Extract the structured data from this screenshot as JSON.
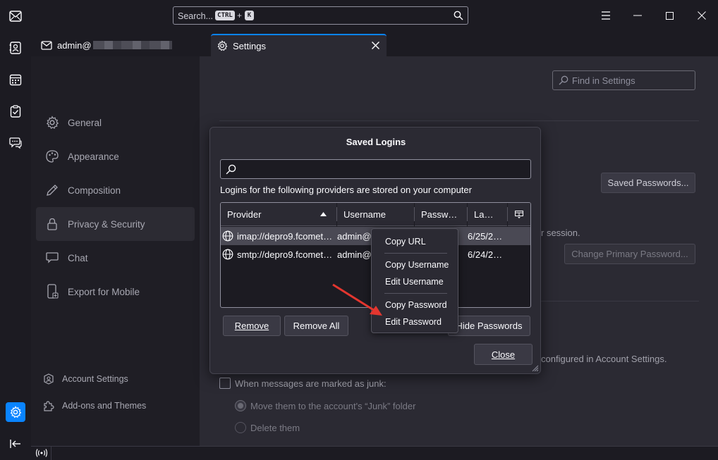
{
  "titlebar": {
    "search_placeholder": "Search...",
    "shortcut_key1": "CTRL",
    "shortcut_plus": "+",
    "shortcut_key2": "K"
  },
  "tabs": [
    {
      "label": "admin@",
      "icon": "mail-icon"
    },
    {
      "label": "Settings",
      "icon": "gear-icon"
    }
  ],
  "settings": {
    "find_placeholder": "Find in Settings",
    "categories": [
      {
        "label": "General",
        "icon": "gear-icon"
      },
      {
        "label": "Appearance",
        "icon": "palette-icon"
      },
      {
        "label": "Composition",
        "icon": "pencil-icon"
      },
      {
        "label": "Privacy & Security",
        "icon": "lock-icon"
      },
      {
        "label": "Chat",
        "icon": "chat-icon"
      },
      {
        "label": "Export for Mobile",
        "icon": "mobile-icon"
      }
    ],
    "bottom_links": [
      {
        "label": "Account Settings",
        "icon": "account-icon"
      },
      {
        "label": "Add-ons and Themes",
        "icon": "puzzle-icon"
      }
    ],
    "saved_passwords_button": "Saved Passwords...",
    "session_text": "r session.",
    "change_primary_password": "Change Primary Password...",
    "account_settings_text": "configured in Account Settings.",
    "junk_checkbox_label": "When messages are marked as junk:",
    "junk_option_move": "Move them to the account's “Junk” folder",
    "junk_option_delete": "Delete them"
  },
  "dialog": {
    "title": "Saved Logins",
    "info": "Logins for the following providers are stored on your computer",
    "columns": [
      "Provider",
      "Username",
      "Passw…",
      "La…"
    ],
    "rows": [
      {
        "provider": "imap://depro9.fcomet…",
        "username": "admin@",
        "last": "6/25/2…"
      },
      {
        "provider": "smtp://depro9.fcomet…",
        "username": "admin@",
        "last": "6/24/2…"
      }
    ],
    "remove_button": "Remove",
    "remove_all_button": "Remove All",
    "hide_passwords_button": "Hide Passwords",
    "close_button": "Close"
  },
  "context_menu": {
    "copy_url": "Copy URL",
    "copy_username": "Copy Username",
    "edit_username": "Edit Username",
    "copy_password": "Copy Password",
    "edit_password": "Edit Password"
  },
  "colors": {
    "accent": "#0a84ff",
    "arrow": "#e3362f",
    "active_space": "#0a84ff"
  }
}
